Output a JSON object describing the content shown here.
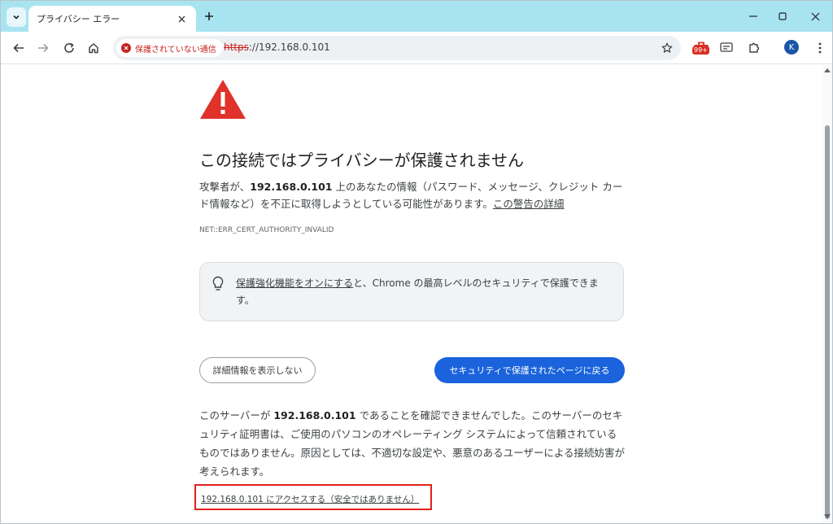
{
  "tab": {
    "title": "プライバシー エラー"
  },
  "omnibox": {
    "security_label": "保護されていない通信",
    "url_scheme": "https",
    "url_rest": "://192.168.0.101"
  },
  "extension": {
    "badge": "99+"
  },
  "profile": {
    "initial": "K"
  },
  "page": {
    "heading": "この接続ではプライバシーが保護されません",
    "desc_prefix": "攻撃者が、",
    "host": "192.168.0.101",
    "desc_suffix": " 上のあなたの情報（パスワード、メッセージ、クレジット カード情報など）を不正に取得しようとしている可能性があります。",
    "learn_more": "この警告の詳細",
    "error_code": "NET::ERR_CERT_AUTHORITY_INVALID",
    "tip_link": "保護強化機能をオンにする",
    "tip_rest": "と、Chrome の最高レベルのセキュリティで保護できます。",
    "details_button": "詳細情報を表示しない",
    "back_button": "セキュリティで保護されたページに戻る",
    "detail_prefix": "このサーバーが ",
    "detail_host": "192.168.0.101",
    "detail_suffix": " であることを確認できませんでした。このサーバーのセキュリティ証明書は、ご使用のパソコンのオペレーティング システムによって信頼されているものではありません。原因としては、不適切な設定や、悪意のあるユーザーによる接続妨害が考えられます。",
    "proceed_link": "192.168.0.101 にアクセスする（安全ではありません）"
  },
  "colors": {
    "tabstrip": "#a7e4f0",
    "warning_red": "#e0312b",
    "primary_blue": "#1a63dc",
    "highlight_box": "#e0201b"
  }
}
